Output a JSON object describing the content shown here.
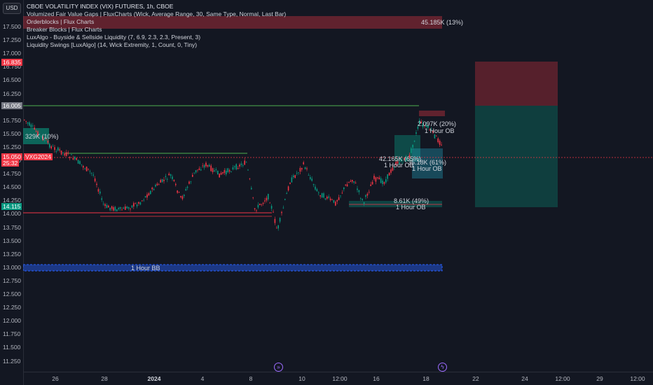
{
  "header": {
    "title": "CBOE VOLATILITY INDEX (VIX) FUTURES, 1h, CBOE",
    "indicators": [
      "Volumized Fair Value Gaps | FluxCharts (Wick, Average Range, 30, Same Type, Normal, Last Bar)",
      "Orderblocks | Flux Charts",
      "Breaker Blocks | Flux Charts",
      "LuxAlgo - Buyside & Sellside Liquidity (7, 6.9, 2.3, 2.3, Present, 3)",
      "Liquidity Swings [LuxAlgo] (14, Wick Extremity, 1, Count, 0, Tiny)"
    ]
  },
  "currency_button": "USD",
  "y_axis": {
    "ticks": [
      "17.500",
      "17.250",
      "17.000",
      "16.750",
      "16.500",
      "16.250",
      "16.000",
      "15.750",
      "15.500",
      "15.250",
      "15.000",
      "14.750",
      "14.500",
      "14.250",
      "14.000",
      "13.750",
      "13.500",
      "13.250",
      "13.000",
      "12.750",
      "12.500",
      "12.250",
      "12.000",
      "11.750",
      "11.500",
      "11.250"
    ],
    "tags": [
      {
        "text": "16.835",
        "color": "#f23645"
      },
      {
        "text": "16.005",
        "color": "#787b86"
      },
      {
        "text": "15.050",
        "color": "#f23645"
      },
      {
        "text": "VXG2024",
        "color": "#f23645"
      },
      {
        "text": "25:32",
        "color": "#f23645"
      },
      {
        "text": "14.115",
        "color": "#089981"
      }
    ]
  },
  "x_axis": {
    "ticks": [
      {
        "label": "26",
        "bold": false
      },
      {
        "label": "28",
        "bold": false
      },
      {
        "label": "2024",
        "bold": true
      },
      {
        "label": "4",
        "bold": false
      },
      {
        "label": "8",
        "bold": false
      },
      {
        "label": "10",
        "bold": false
      },
      {
        "label": "12:00",
        "bold": false
      },
      {
        "label": "16",
        "bold": false
      },
      {
        "label": "18",
        "bold": false
      },
      {
        "label": "22",
        "bold": false
      },
      {
        "label": "24",
        "bold": false
      },
      {
        "label": "12:00",
        "bold": false
      },
      {
        "label": "29",
        "bold": false
      },
      {
        "label": "12:00",
        "bold": false
      }
    ]
  },
  "annotations": {
    "fvg_top": "45.185K (13%)",
    "ob_left": "329K (10%)",
    "ob_upper_right": "2.097K (20%)",
    "ob_upper_right_label": "1 Hour OB",
    "ob_mid_left": "42.165K (65%)",
    "ob_mid_left_label": "1 Hour OB",
    "ob_mid_right": "35.18K (61%)",
    "ob_mid_right_label": "1 Hour OB",
    "ob_low": "8.61K (49%)",
    "ob_low_label": "1 Hour OB",
    "bb_label": "1 Hour BB"
  },
  "colors": {
    "background": "#131722",
    "bull": "#089981",
    "bear": "#f23645",
    "bb_blue": "#2962ff"
  },
  "icons": {
    "nav_left": "fast-forward-circle-icon",
    "nav_right": "lightning-circle-icon"
  }
}
